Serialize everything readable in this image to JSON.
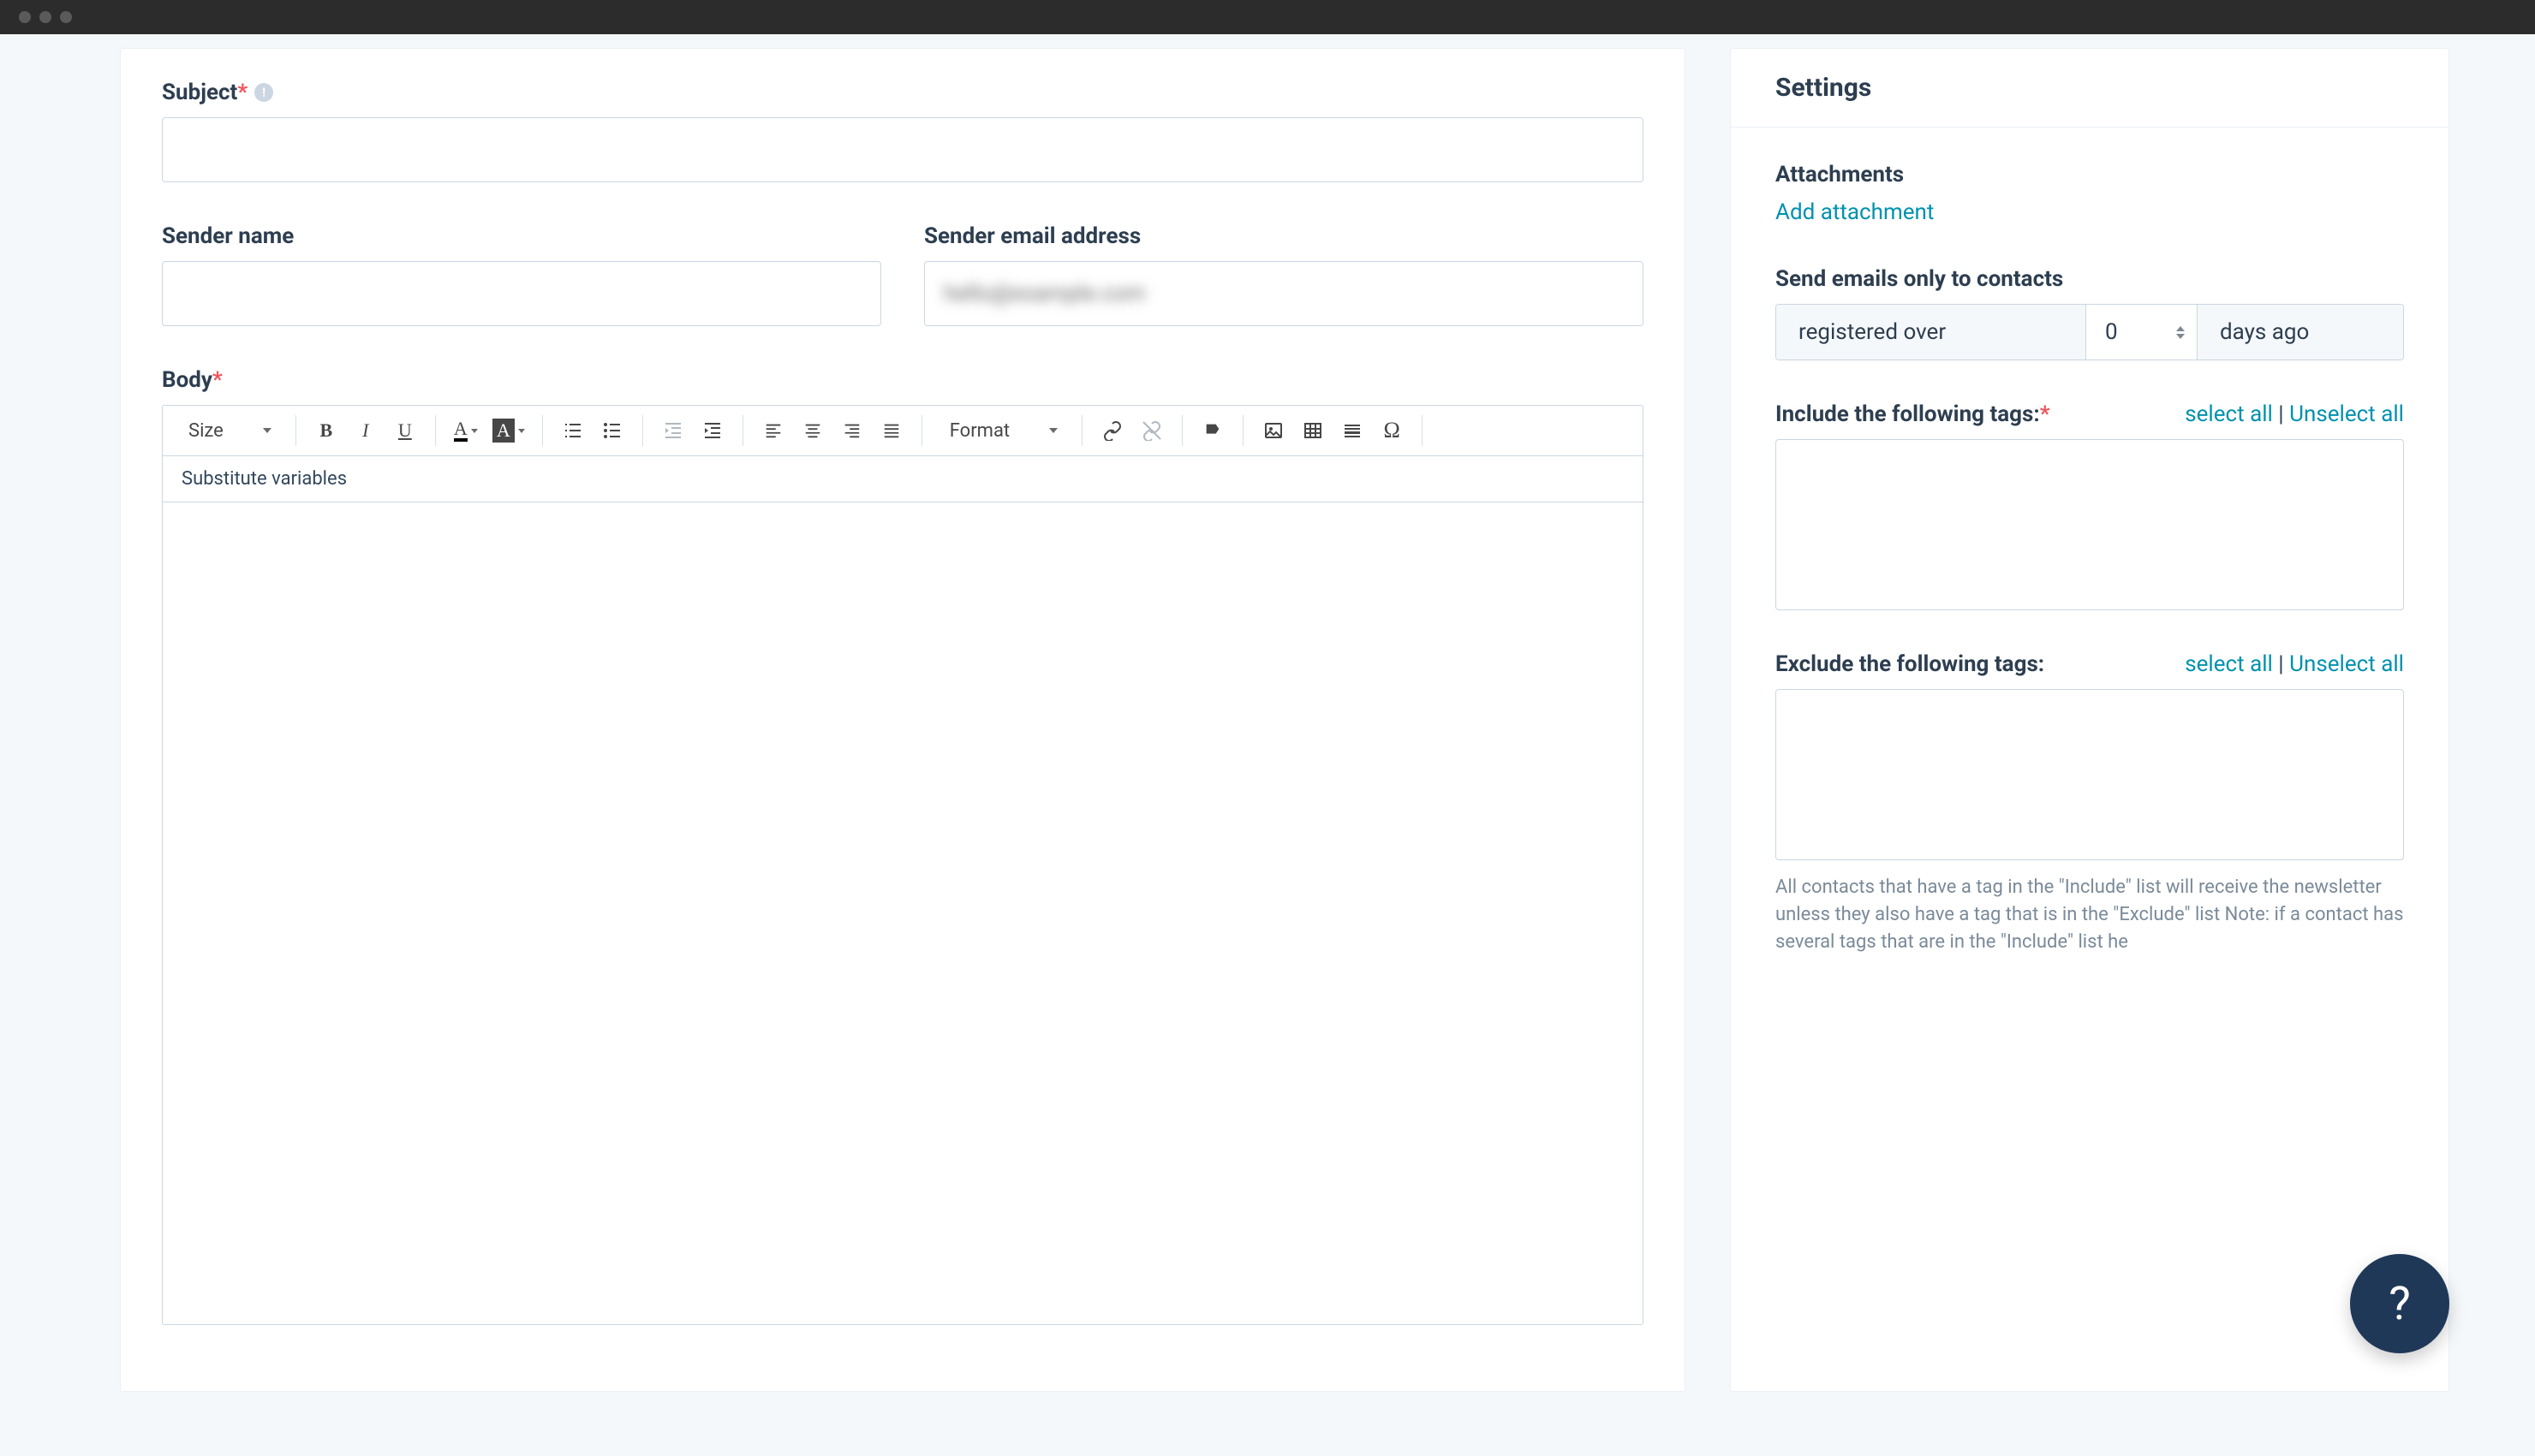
{
  "main": {
    "subject_label": "Subject",
    "subject_value": "",
    "sender_name_label": "Sender name",
    "sender_name_value": "",
    "sender_email_label": "Sender email address",
    "sender_email_value": "hello@example.com",
    "body_label": "Body"
  },
  "toolbar": {
    "size_label": "Size",
    "format_label": "Format",
    "substitute_label": "Substitute variables"
  },
  "sidebar": {
    "title": "Settings",
    "attachments_label": "Attachments",
    "add_attachment": "Add attachment",
    "send_only_label": "Send emails only to contacts",
    "filter_select": "registered over",
    "filter_num": "0",
    "filter_suffix": "days ago",
    "include_label": "Include the following tags:",
    "exclude_label": "Exclude the following tags:",
    "select_all": "select all",
    "unselect_all": "Unselect all",
    "separator": " | ",
    "note_text": "All contacts that have a tag in the \"Include\" list will receive the newsletter unless they also have a tag that is in the \"Exclude\" list Note: if a contact has several tags that are in the \"Include\" list he"
  }
}
